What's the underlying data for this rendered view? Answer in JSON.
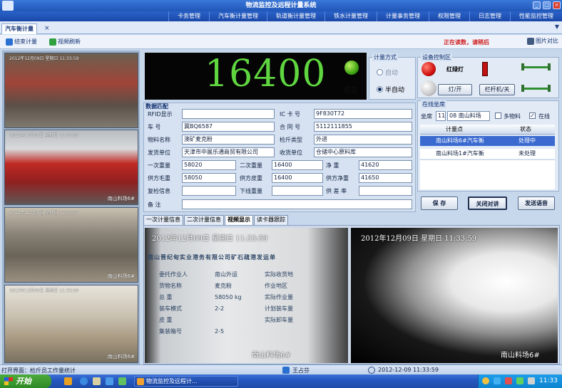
{
  "window": {
    "title": "物流监控及远程计量系统"
  },
  "menu": [
    "卡务管理",
    "汽车衡计量管理",
    "轨道衡计量管理",
    "铁水计量管理",
    "计量事务管理",
    "权限管理",
    "日志管理",
    "性能监控管理"
  ],
  "tab": {
    "label": "汽车衡计量",
    "close": "×",
    "menu": "▼"
  },
  "toolbar": {
    "end": "结束计量",
    "refresh": "视频刷新",
    "read_tip": "正在读数，请稍后",
    "pic_compare": "图片对比"
  },
  "cameras": [
    {
      "ts": "2012年12月09日  星期日  11:33:59",
      "loc": ""
    },
    {
      "ts": "2012年12月09日  星期日  11:33:59",
      "loc": "南山料场6#"
    },
    {
      "ts": "2012年12月09日  星期日  11:33:59",
      "loc": "南山料场6#"
    },
    {
      "ts": "2012年12月09日  星期日  11:33:59",
      "loc": "南山料场6#"
    }
  ],
  "weight": {
    "value": "16400",
    "stable": "稳定"
  },
  "mode": {
    "title": "计量方式",
    "auto": "自动",
    "semi": "半自动"
  },
  "device": {
    "title": "设备控制区",
    "traffic": "红绿灯",
    "light": "灯/开",
    "gate": "栏杆机/关"
  },
  "form": {
    "title": "数据匹配",
    "rfid": "RFID显示",
    "ic": "IC 卡 号",
    "ic_v": "9F830T72",
    "plate": "车    号",
    "plate_v": "冀BQ6587",
    "contract": "合 同 号",
    "contract_v": "5112111855",
    "material": "物料名称",
    "material_v": "澳矿麦克粉",
    "insp": "检斤类型",
    "insp_v": "外进",
    "sender": "发货单位",
    "sender_v": "天津市中展乐通商贸有限公司",
    "receiver": "收货单位",
    "receiver_v": "仓储中心原料库",
    "w1": "一次重量",
    "w1_v": "58020",
    "w2": "二次重量",
    "w2_v": "16400",
    "net": "净    重",
    "net_v": "41620",
    "sgross": "供方毛重",
    "sgross_v": "58050",
    "star": "供方皮重",
    "star_v": "16400",
    "snet": "供方净重",
    "snet_v": "41650",
    "recheck": "复检信息",
    "unload": "下线重量",
    "diff": "供 差 率",
    "remark": "备    注"
  },
  "online": {
    "title": "在线坐席",
    "seat": "坐席",
    "seat_no": "11",
    "seat_name": "08 南山料场",
    "multi": "多物料",
    "online": "在线",
    "col1": "计量点",
    "col2": "状态",
    "rows": [
      {
        "point": "南山料场6#汽车衡",
        "status": "处理中"
      },
      {
        "point": "南山料场1#汽车衡",
        "status": "未处理"
      }
    ]
  },
  "buttons": {
    "save": "保 存",
    "close_talk": "关闭对讲",
    "voice": "发送语音"
  },
  "subtabs": [
    "一次计量信息",
    "二次计量信息",
    "视频显示",
    "读卡器跟踪"
  ],
  "videos": [
    {
      "ts": "2012年12月09日  星期日  11:33:59",
      "loc": "南山料场6#"
    },
    {
      "ts": "2012年12月09日  星期日  11:33:59",
      "loc": "南山料场6#"
    }
  ],
  "ticket": {
    "head": "南山晋纪甸实业港务有限公司矿石疏港发运单",
    "rows": [
      [
        "委托作业人",
        "南山外运",
        "实际收货地"
      ],
      [
        "货物名称",
        "麦克粉",
        "作业地区"
      ],
      [
        "总    重",
        "58050 kg",
        "实际作业量"
      ],
      [
        "装车模式",
        "2-2",
        "计划装车量"
      ],
      [
        "皮    重",
        "",
        "实际卸车量"
      ],
      [
        "集装箱号",
        "2-5",
        ""
      ]
    ]
  },
  "status": {
    "left": "打开界面：检斤员工作量统计",
    "user": "王占芬",
    "time": "2012-12-09   11:33:59"
  },
  "taskbar": {
    "start": "开始",
    "app": "物流监控及远程计...",
    "clock": "11:33"
  }
}
